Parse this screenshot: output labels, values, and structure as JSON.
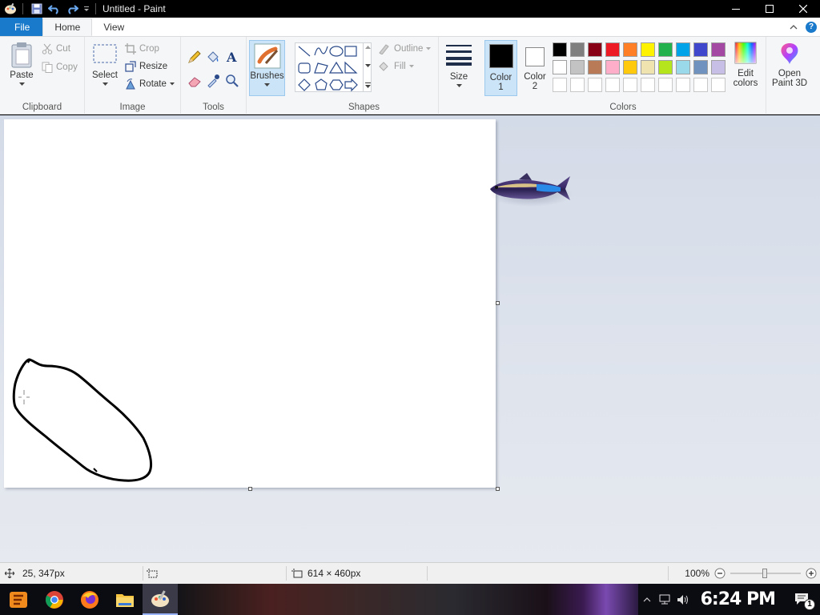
{
  "window": {
    "title": "Untitled - Paint"
  },
  "tabs": {
    "file": "File",
    "home": "Home",
    "view": "View"
  },
  "clipboard": {
    "paste": "Paste",
    "cut": "Cut",
    "copy": "Copy",
    "group": "Clipboard"
  },
  "image": {
    "select": "Select",
    "crop": "Crop",
    "resize": "Resize",
    "rotate": "Rotate",
    "group": "Image"
  },
  "tools": {
    "group": "Tools"
  },
  "brushes": {
    "label": "Brushes"
  },
  "shapes": {
    "outline": "Outline",
    "fill": "Fill",
    "group": "Shapes"
  },
  "size": {
    "label": "Size"
  },
  "colors": {
    "color1": "Color",
    "color1_num": "1",
    "color2": "Color",
    "color2_num": "2",
    "edit": "Edit",
    "edit2": "colors",
    "paint3d": "Open",
    "paint3d2": "Paint 3D",
    "group": "Colors",
    "color1_value": "#000000",
    "color2_value": "#ffffff",
    "palette_row1": [
      "#000000",
      "#7f7f7f",
      "#880015",
      "#ed1c24",
      "#ff7f27",
      "#fff200",
      "#22b14c",
      "#00a2e8",
      "#3f48cc",
      "#a349a4"
    ],
    "palette_row2": [
      "#ffffff",
      "#c3c3c3",
      "#b97a57",
      "#ffaec9",
      "#ffc90e",
      "#efe4b0",
      "#b5e61d",
      "#99d9ea",
      "#7092be",
      "#c8bfe7"
    ]
  },
  "status": {
    "cursor": "25, 347px",
    "canvas_size": "614 × 460px",
    "zoom": "100%"
  },
  "taskbar": {
    "clock": "6:24 PM",
    "notifications": "1"
  }
}
